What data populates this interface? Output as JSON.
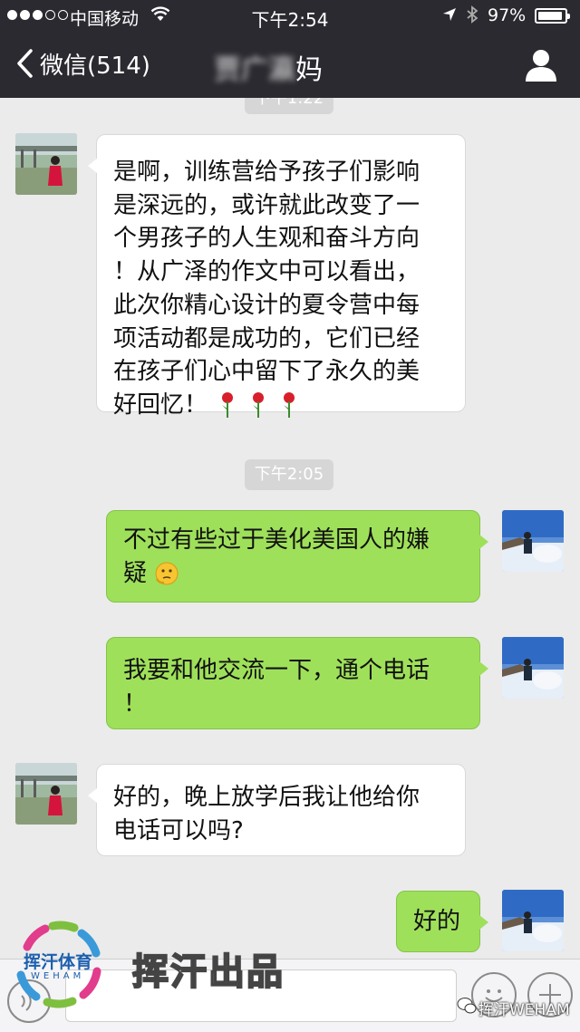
{
  "status_bar": {
    "carrier": "中国移动",
    "time": "下午2:54",
    "battery": "97%"
  },
  "nav": {
    "back_label": "微信(514)",
    "title_obscured": "贾广瀛",
    "title_suffix": "妈"
  },
  "chat": {
    "top_partial_time": "下午1:22",
    "messages": [
      {
        "side": "left",
        "lines": [
          "是啊，训练营给予孩子们影响",
          "是深远的，或许就此改变了一",
          "个男孩子的人生观和奋斗方向",
          "！从广泽的作文中可以看出，",
          "此次你精心设计的夏令营中每",
          "项活动都是成功的，它们已经",
          "在孩子们心中留下了永久的美",
          "好回忆！"
        ],
        "trailing_emoji": "rose-emoji-x3"
      },
      {
        "type": "time",
        "text": "下午2:05"
      },
      {
        "side": "right",
        "lines": [
          "不过有些过于美化美国人的嫌",
          "疑"
        ],
        "trailing_emoji": "thinking-face-emoji"
      },
      {
        "side": "right",
        "lines": [
          "我要和他交流一下，通个电话",
          "！"
        ]
      },
      {
        "side": "left",
        "lines": [
          "好的，晚上放学后我让他给你",
          "电话可以吗?"
        ]
      },
      {
        "side": "right",
        "lines": [
          "好的"
        ]
      }
    ]
  },
  "watermark": {
    "logo_text": "挥汗体育",
    "logo_sub": "WEHAM",
    "center_text": "挥汗出品",
    "corner_text": "挥汗WEHAM"
  },
  "colors": {
    "header_bg": "#2b2a30",
    "chat_bg": "#ebebeb",
    "bubble_sent": "#9fe05a",
    "bubble_received": "#ffffff"
  }
}
